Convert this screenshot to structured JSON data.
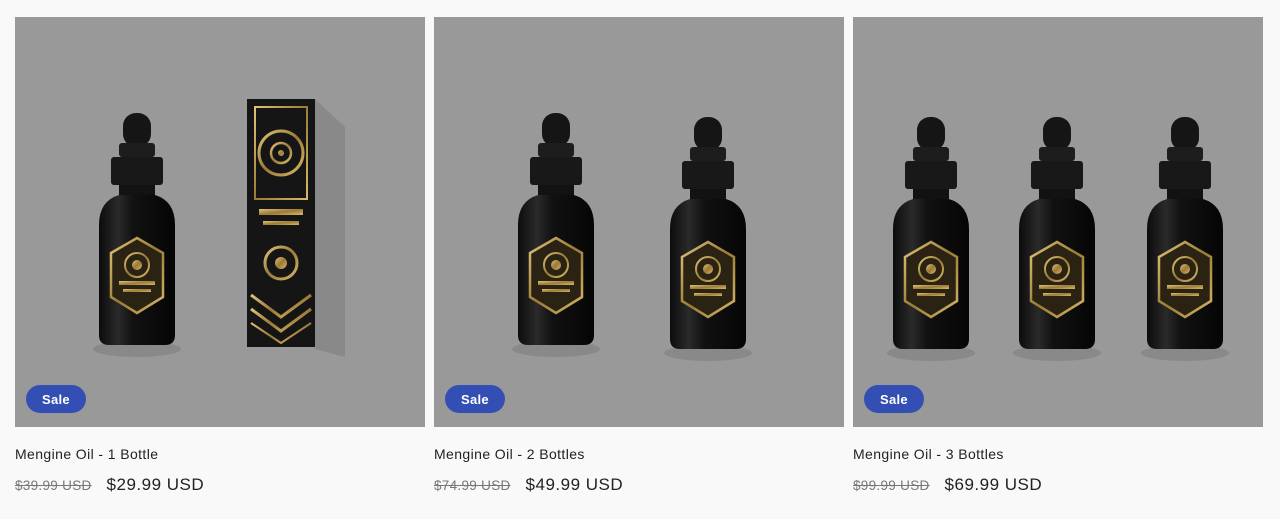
{
  "products": [
    {
      "title": "Mengine Oil - 1 Bottle",
      "badge": "Sale",
      "compare_price": "$39.99 USD",
      "sale_price": "$29.99 USD"
    },
    {
      "title": "Mengine Oil - 2 Bottles",
      "badge": "Sale",
      "compare_price": "$74.99 USD",
      "sale_price": "$49.99 USD"
    },
    {
      "title": "Mengine Oil - 3 Bottles",
      "badge": "Sale",
      "compare_price": "$99.99 USD",
      "sale_price": "$69.99 USD"
    }
  ],
  "colors": {
    "page_background": "#f9f9f9",
    "image_background": "#999999",
    "badge_background": "#334fb4",
    "badge_text": "#ffffff",
    "bottle": "#141414",
    "label_gold": "#b8954a"
  }
}
